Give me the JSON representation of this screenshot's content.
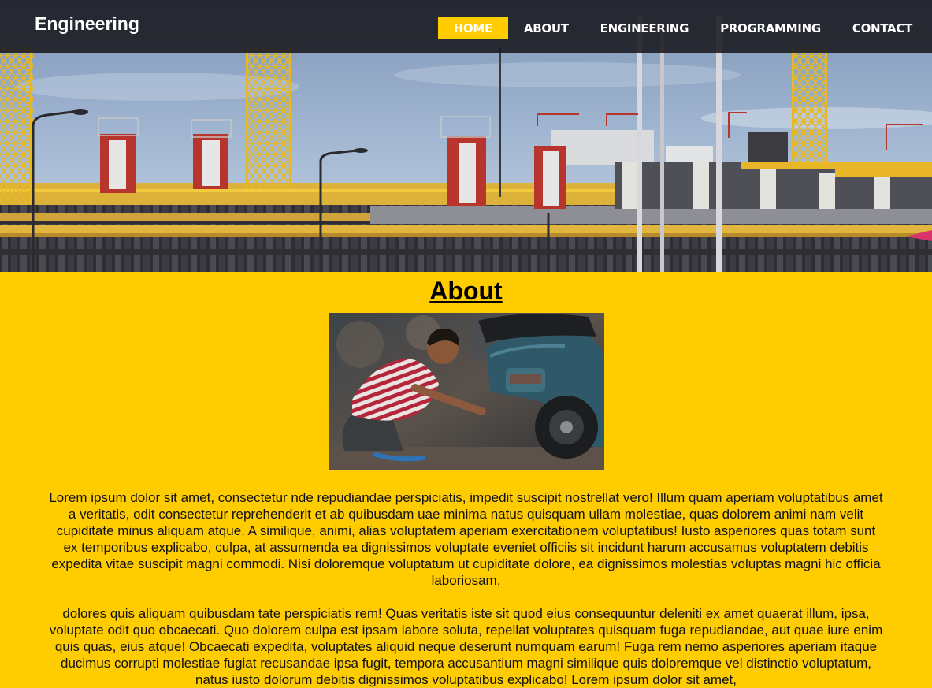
{
  "nav": {
    "brand": "Engineering",
    "items": [
      {
        "label": "HOME",
        "active": true
      },
      {
        "label": "ABOUT",
        "active": false
      },
      {
        "label": "ENGINEERING",
        "active": false
      },
      {
        "label": "PROGRAMMING",
        "active": false
      },
      {
        "label": "CONTACT",
        "active": false
      }
    ]
  },
  "hero": {
    "image": "construction-site-cranes-photo"
  },
  "about": {
    "title": "About",
    "image": "mechanic-repairing-scooter-photo",
    "paragraphs": [
      "Lorem ipsum dolor sit amet, consectetur nde repudiandae perspiciatis, impedit suscipit nostrellat vero! Illum quam aperiam voluptatibus amet a veritatis, odit consectetur reprehenderit et ab quibusdam uae minima natus quisquam ullam molestiae, quas dolorem animi nam velit cupiditate minus aliquam atque. A similique, animi, alias voluptatem aperiam exercitationem voluptatibus! Iusto asperiores quas totam sunt ex temporibus explicabo, culpa, at assumenda ea dignissimos voluptate eveniet officiis sit incidunt harum accusamus voluptatem debitis expedita vitae suscipit magni commodi. Nisi doloremque voluptatum ut cupiditate dolore, ea dignissimos molestias voluptas magni hic officia laboriosam,",
      "dolores quis aliquam quibusdam tate perspiciatis rem! Quas veritatis iste sit quod eius consequuntur deleniti ex amet quaerat illum, ipsa, voluptate odit quo obcaecati. Quo dolorem culpa est ipsam labore soluta, repellat voluptates quisquam fuga repudiandae, aut quae iure enim quis quas, eius atque! Obcaecati expedita, voluptates aliquid neque deserunt numquam earum! Fuga rem nemo asperiores aperiam itaque ducimus corrupti molestiae fugiat recusandae ipsa fugit, tempora accusantium magni similique quis doloremque vel distinctio voluptatum, natus iusto dolorum debitis dignissimos voluptatibus explicabo! Lorem ipsum dolor sit amet,"
    ]
  },
  "colors": {
    "accent": "#ffcc00",
    "nav_bg": "#19191e",
    "text": "#111111"
  }
}
